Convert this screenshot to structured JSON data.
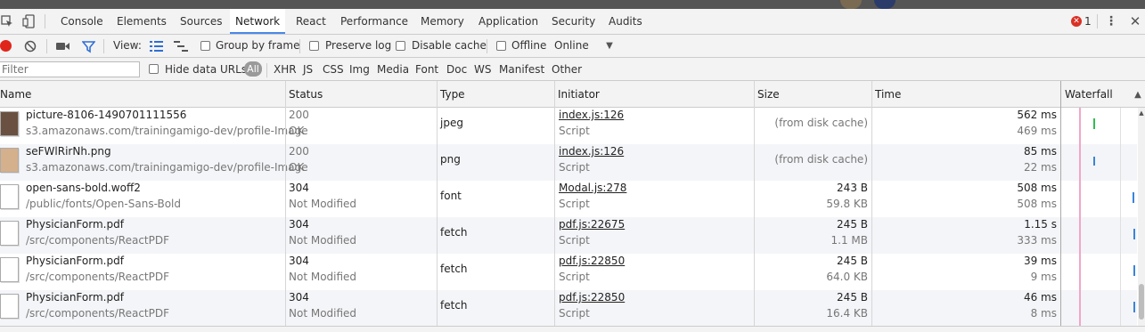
{
  "tabs": [
    {
      "label": "Console"
    },
    {
      "label": "Elements"
    },
    {
      "label": "Sources"
    },
    {
      "label": "Network"
    },
    {
      "label": "React"
    },
    {
      "label": "Performance"
    },
    {
      "label": "Memory"
    },
    {
      "label": "Application"
    },
    {
      "label": "Security"
    },
    {
      "label": "Audits"
    }
  ],
  "active_tab": "Network",
  "error_count": "1",
  "toolbar": {
    "view_label": "View:",
    "group_by_frame": "Group by frame",
    "preserve_log": "Preserve log",
    "disable_cache": "Disable cache",
    "offline": "Offline",
    "throttle_value": "Online"
  },
  "filter": {
    "placeholder": "Filter",
    "hide_data_urls": "Hide data URLs",
    "all": "All",
    "types": [
      "XHR",
      "JS",
      "CSS",
      "Img",
      "Media",
      "Font",
      "Doc",
      "WS",
      "Manifest",
      "Other"
    ]
  },
  "columns": {
    "name": "Name",
    "status": "Status",
    "type": "Type",
    "initiator": "Initiator",
    "size": "Size",
    "time": "Time",
    "waterfall": "Waterfall"
  },
  "rows": [
    {
      "name": "picture-8106-1490701111556",
      "path": "s3.amazonaws.com/trainingamigo-dev/profile-Image",
      "status": "200",
      "status_text": "OK",
      "type": "jpeg",
      "initiator": "index.js:126",
      "initiator_type": "Script",
      "size": "(from disk cache)",
      "size2": "",
      "time": "562 ms",
      "latency": "469 ms",
      "wf_color": "#2ebd4f"
    },
    {
      "name": "seFWlRirNh.png",
      "path": "s3.amazonaws.com/trainingamigo-dev/profile-Image",
      "status": "200",
      "status_text": "OK",
      "type": "png",
      "initiator": "index.js:126",
      "initiator_type": "Script",
      "size": "(from disk cache)",
      "size2": "",
      "time": "85 ms",
      "latency": "22 ms",
      "wf_color": "#3a84d9"
    },
    {
      "name": "open-sans-bold.woff2",
      "path": "/public/fonts/Open-Sans-Bold",
      "status": "304",
      "status_text": "Not Modified",
      "type": "font",
      "initiator": "Modal.js:278",
      "initiator_type": "Script",
      "size": "243 B",
      "size2": "59.8 KB",
      "time": "508 ms",
      "latency": "508 ms",
      "wf_color": "#3a84d9"
    },
    {
      "name": "PhysicianForm.pdf",
      "path": "/src/components/ReactPDF",
      "status": "304",
      "status_text": "Not Modified",
      "type": "fetch",
      "initiator": "pdf.js:22675",
      "initiator_type": "Script",
      "size": "245 B",
      "size2": "1.1 MB",
      "time": "1.15 s",
      "latency": "333 ms",
      "wf_color": "#3a84d9"
    },
    {
      "name": "PhysicianForm.pdf",
      "path": "/src/components/ReactPDF",
      "status": "304",
      "status_text": "Not Modified",
      "type": "fetch",
      "initiator": "pdf.js:22850",
      "initiator_type": "Script",
      "size": "245 B",
      "size2": "64.0 KB",
      "time": "39 ms",
      "latency": "9 ms",
      "wf_color": "#3a84d9"
    },
    {
      "name": "PhysicianForm.pdf",
      "path": "/src/components/ReactPDF",
      "status": "304",
      "status_text": "Not Modified",
      "type": "fetch",
      "initiator": "pdf.js:22850",
      "initiator_type": "Script",
      "size": "245 B",
      "size2": "16.4 KB",
      "time": "46 ms",
      "latency": "8 ms",
      "wf_color": "#3a84d9"
    }
  ],
  "colors": {
    "record": "#e0251b",
    "accent": "#4a88e8",
    "filter_icon": "#2f6fd6",
    "error": "#d93025",
    "pink_line": "#f2a6c8"
  }
}
